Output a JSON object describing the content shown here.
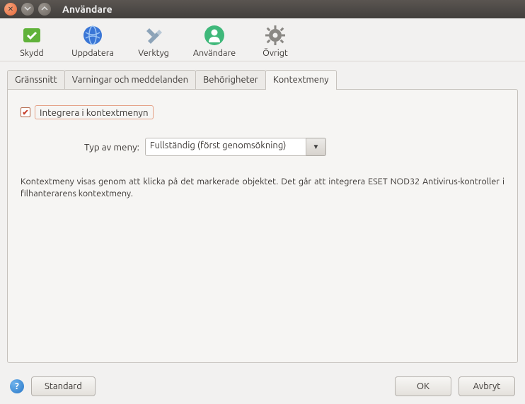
{
  "window": {
    "title": "Användare"
  },
  "toolbar": {
    "items": [
      {
        "label": "Skydd",
        "icon": "shield-icon"
      },
      {
        "label": "Uppdatera",
        "icon": "globe-icon"
      },
      {
        "label": "Verktyg",
        "icon": "tools-icon"
      },
      {
        "label": "Användare",
        "icon": "user-icon"
      },
      {
        "label": "Övrigt",
        "icon": "gear-icon"
      }
    ]
  },
  "tabs": {
    "items": [
      {
        "label": "Gränssnitt"
      },
      {
        "label": "Varningar och meddelanden"
      },
      {
        "label": "Behörigheter"
      },
      {
        "label": "Kontextmeny"
      }
    ],
    "active": 3
  },
  "contextmenu": {
    "checkbox_label": "Integrera i kontextmenyn",
    "checked": true,
    "menu_type_label": "Typ av meny:",
    "menu_type_value": "Fullständig (först genomsökning)",
    "description": "Kontextmeny visas genom att klicka på det markerade objektet. Det går att integrera ESET NOD32 Antivirus-kontroller i filhanterarens kontextmeny."
  },
  "footer": {
    "standard": "Standard",
    "ok": "OK",
    "cancel": "Avbryt"
  }
}
